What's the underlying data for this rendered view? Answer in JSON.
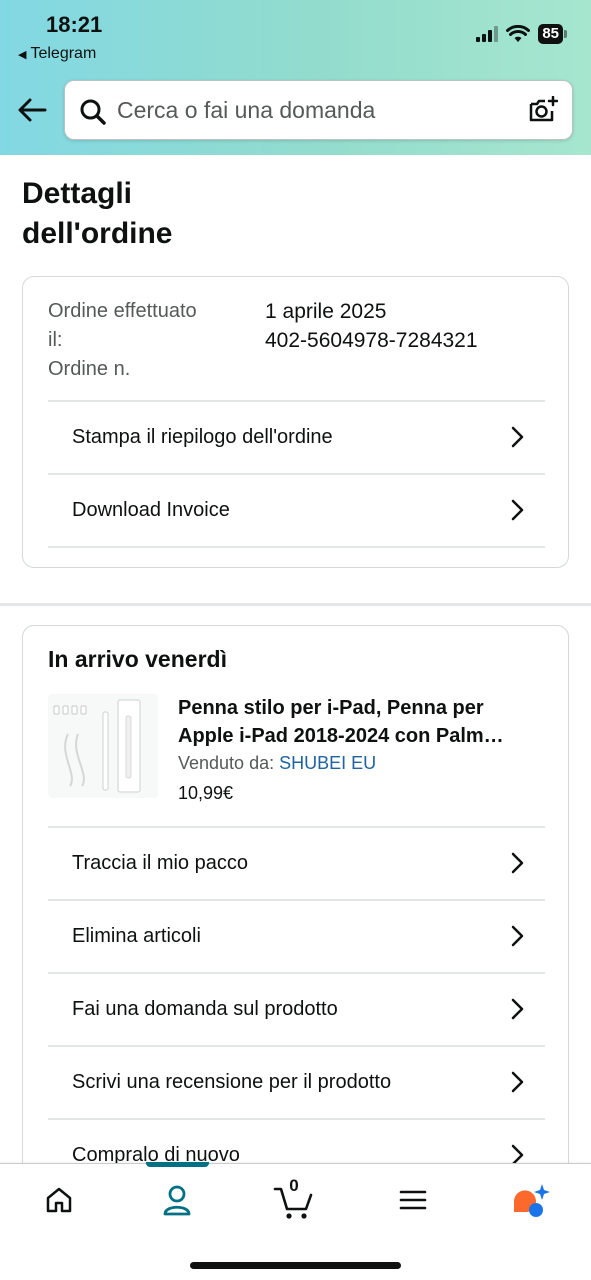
{
  "status_bar": {
    "time": "18:21",
    "back_app": "Telegram",
    "battery": "85"
  },
  "search": {
    "placeholder": "Cerca o fai una domanda"
  },
  "page_title_line1": "Dettagli",
  "page_title_line2": "dell'ordine",
  "order_info": {
    "placed_label_line1": "Ordine effettuato",
    "placed_label_line2": "il:",
    "number_label": "Ordine n.",
    "placed_value": "1 aprile 2025",
    "number_value": "402-5604978-7284321"
  },
  "order_actions": [
    {
      "label": "Stampa il riepilogo dell'ordine"
    },
    {
      "label": "Download Invoice"
    }
  ],
  "shipment": {
    "heading": "In arrivo venerdì",
    "product": {
      "title_line1": "Penna stilo per i-Pad, Penna per",
      "title_line2": "Apple i-Pad 2018-2024 con Palm…",
      "seller_prefix": "Venduto da:",
      "seller_name": "SHUBEI EU",
      "price": "10,99€"
    },
    "actions": [
      {
        "label": "Traccia il mio pacco"
      },
      {
        "label": "Elimina articoli"
      },
      {
        "label": "Fai una domanda sul prodotto"
      },
      {
        "label": "Scrivi una recensione per il prodotto"
      },
      {
        "label": "Compralo di nuovo"
      }
    ]
  },
  "bottom_nav": {
    "cart_count": "0",
    "items": [
      "home-icon",
      "account-icon",
      "cart-icon",
      "menu-icon",
      "ai-assistant-icon"
    ],
    "accent_color": "#007185"
  },
  "colors": {
    "header_gradient_start": "#82d8e3",
    "header_gradient_end": "#a6e6cf",
    "link": "#2162a1"
  }
}
